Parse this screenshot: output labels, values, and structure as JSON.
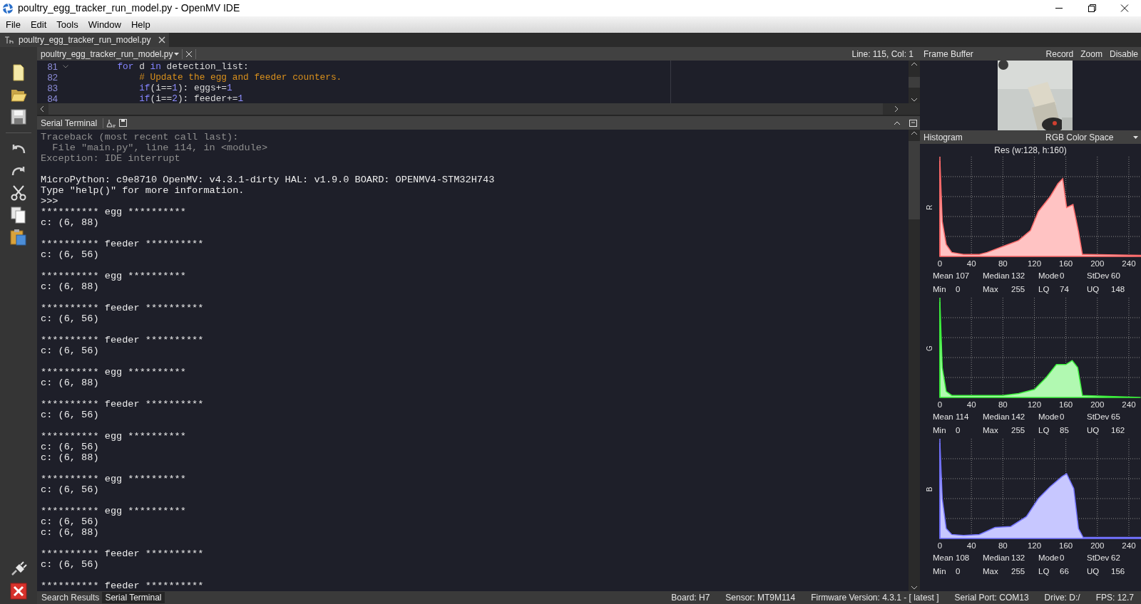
{
  "window": {
    "title": "poultry_egg_tracker_run_model.py - OpenMV IDE"
  },
  "menu": [
    "File",
    "Edit",
    "Tools",
    "Window",
    "Help"
  ],
  "document_tab": {
    "label": "poultry_egg_tracker_run_model.py"
  },
  "editor": {
    "file": "poultry_egg_tracker_run_model.py",
    "position": "Line: 115, Col: 1",
    "lines": [
      {
        "number": "81",
        "foldable": true,
        "segments": [
          {
            "kind": "keyword",
            "text": "        for"
          },
          {
            "kind": "plain",
            "text": " d "
          },
          {
            "kind": "keyword",
            "text": "in"
          },
          {
            "kind": "plain",
            "text": " detection_list:"
          }
        ]
      },
      {
        "number": "82",
        "foldable": false,
        "segments": [
          {
            "kind": "comment",
            "text": "            # Update the egg and feeder counters."
          }
        ]
      },
      {
        "number": "83",
        "foldable": false,
        "segments": [
          {
            "kind": "keyword",
            "text": "            if"
          },
          {
            "kind": "plain",
            "text": "(i=="
          },
          {
            "kind": "number",
            "text": "1"
          },
          {
            "kind": "plain",
            "text": "): eggs+="
          },
          {
            "kind": "number",
            "text": "1"
          }
        ]
      },
      {
        "number": "84",
        "foldable": false,
        "segments": [
          {
            "kind": "keyword",
            "text": "            if"
          },
          {
            "kind": "plain",
            "text": "(i=="
          },
          {
            "kind": "number",
            "text": "2"
          },
          {
            "kind": "plain",
            "text": "): feeder+="
          },
          {
            "kind": "number",
            "text": "1"
          }
        ]
      }
    ]
  },
  "serial_terminal": {
    "title": "Serial Terminal",
    "lines": [
      {
        "kind": "error",
        "text": "Traceback (most recent call last):"
      },
      {
        "kind": "error",
        "text": "  File \"main.py\", line 114, in <module>"
      },
      {
        "kind": "error",
        "text": "Exception: IDE interrupt"
      },
      {
        "kind": "blank"
      },
      {
        "kind": "output",
        "text": "MicroPython: c9e8710 OpenMV: v4.3.1-dirty HAL: v1.9.0 BOARD: OPENMV4-STM32H743"
      },
      {
        "kind": "output",
        "text": "Type \"help()\" for more information."
      },
      {
        "kind": "output",
        "text": ">>>"
      },
      {
        "kind": "output",
        "text": "********** egg **********"
      },
      {
        "kind": "output",
        "text": "c: (6, 88)"
      },
      {
        "kind": "blank"
      },
      {
        "kind": "output",
        "text": "********** feeder **********"
      },
      {
        "kind": "output",
        "text": "c: (6, 56)"
      },
      {
        "kind": "blank"
      },
      {
        "kind": "output",
        "text": "********** egg **********"
      },
      {
        "kind": "output",
        "text": "c: (6, 88)"
      },
      {
        "kind": "blank"
      },
      {
        "kind": "output",
        "text": "********** feeder **********"
      },
      {
        "kind": "output",
        "text": "c: (6, 56)"
      },
      {
        "kind": "blank"
      },
      {
        "kind": "output",
        "text": "********** feeder **********"
      },
      {
        "kind": "output",
        "text": "c: (6, 56)"
      },
      {
        "kind": "blank"
      },
      {
        "kind": "output",
        "text": "********** egg **********"
      },
      {
        "kind": "output",
        "text": "c: (6, 88)"
      },
      {
        "kind": "blank"
      },
      {
        "kind": "output",
        "text": "********** feeder **********"
      },
      {
        "kind": "output",
        "text": "c: (6, 56)"
      },
      {
        "kind": "blank"
      },
      {
        "kind": "output",
        "text": "********** egg **********"
      },
      {
        "kind": "output",
        "text": "c: (6, 56)"
      },
      {
        "kind": "output",
        "text": "c: (6, 88)"
      },
      {
        "kind": "blank"
      },
      {
        "kind": "output",
        "text": "********** egg **********"
      },
      {
        "kind": "output",
        "text": "c: (6, 56)"
      },
      {
        "kind": "blank"
      },
      {
        "kind": "output",
        "text": "********** egg **********"
      },
      {
        "kind": "output",
        "text": "c: (6, 56)"
      },
      {
        "kind": "output",
        "text": "c: (6, 88)"
      },
      {
        "kind": "blank"
      },
      {
        "kind": "output",
        "text": "********** feeder **********"
      },
      {
        "kind": "output",
        "text": "c: (6, 56)"
      },
      {
        "kind": "blank"
      },
      {
        "kind": "output",
        "text": "********** feeder **********"
      }
    ]
  },
  "frame_buffer": {
    "title": "Frame Buffer",
    "actions": [
      "Record",
      "Zoom",
      "Disable"
    ]
  },
  "histogram": {
    "title": "Histogram",
    "color_space": "RGB Color Space",
    "resolution": "Res (w:128, h:160)",
    "channels": [
      {
        "label": "R",
        "color": "#ff6a6a",
        "ticks": [
          "0",
          "40",
          "80",
          "120",
          "160",
          "200",
          "240"
        ],
        "stats": [
          {
            "label": "Mean",
            "value": "107"
          },
          {
            "label": "Median",
            "value": "132"
          },
          {
            "label": "Mode",
            "value": "0"
          },
          {
            "label": "StDev",
            "value": "60"
          },
          {
            "label": "Min",
            "value": "0"
          },
          {
            "label": "Max",
            "value": "255"
          },
          {
            "label": "LQ",
            "value": "74"
          },
          {
            "label": "UQ",
            "value": "148"
          }
        ]
      },
      {
        "label": "G",
        "color": "#3cf03c",
        "ticks": [
          "0",
          "40",
          "80",
          "120",
          "160",
          "200",
          "240"
        ],
        "stats": [
          {
            "label": "Mean",
            "value": "114"
          },
          {
            "label": "Median",
            "value": "142"
          },
          {
            "label": "Mode",
            "value": "0"
          },
          {
            "label": "StDev",
            "value": "65"
          },
          {
            "label": "Min",
            "value": "0"
          },
          {
            "label": "Max",
            "value": "255"
          },
          {
            "label": "LQ",
            "value": "85"
          },
          {
            "label": "UQ",
            "value": "162"
          }
        ]
      },
      {
        "label": "B",
        "color": "#7272ff",
        "ticks": [
          "0",
          "40",
          "80",
          "120",
          "160",
          "200",
          "240"
        ],
        "stats": [
          {
            "label": "Mean",
            "value": "108"
          },
          {
            "label": "Median",
            "value": "132"
          },
          {
            "label": "Mode",
            "value": "0"
          },
          {
            "label": "StDev",
            "value": "62"
          },
          {
            "label": "Min",
            "value": "0"
          },
          {
            "label": "Max",
            "value": "255"
          },
          {
            "label": "LQ",
            "value": "66"
          },
          {
            "label": "UQ",
            "value": "156"
          }
        ]
      }
    ]
  },
  "bottom_tabs": [
    {
      "label": "Search Results",
      "selected": false
    },
    {
      "label": "Serial Terminal",
      "selected": true
    }
  ],
  "status_bar": [
    "Board: H7",
    "Sensor: MT9M114",
    "Firmware Version: 4.3.1 - [ latest ]",
    "Serial Port: COM13",
    "Drive: D:/",
    "FPS: 12.7"
  ]
}
